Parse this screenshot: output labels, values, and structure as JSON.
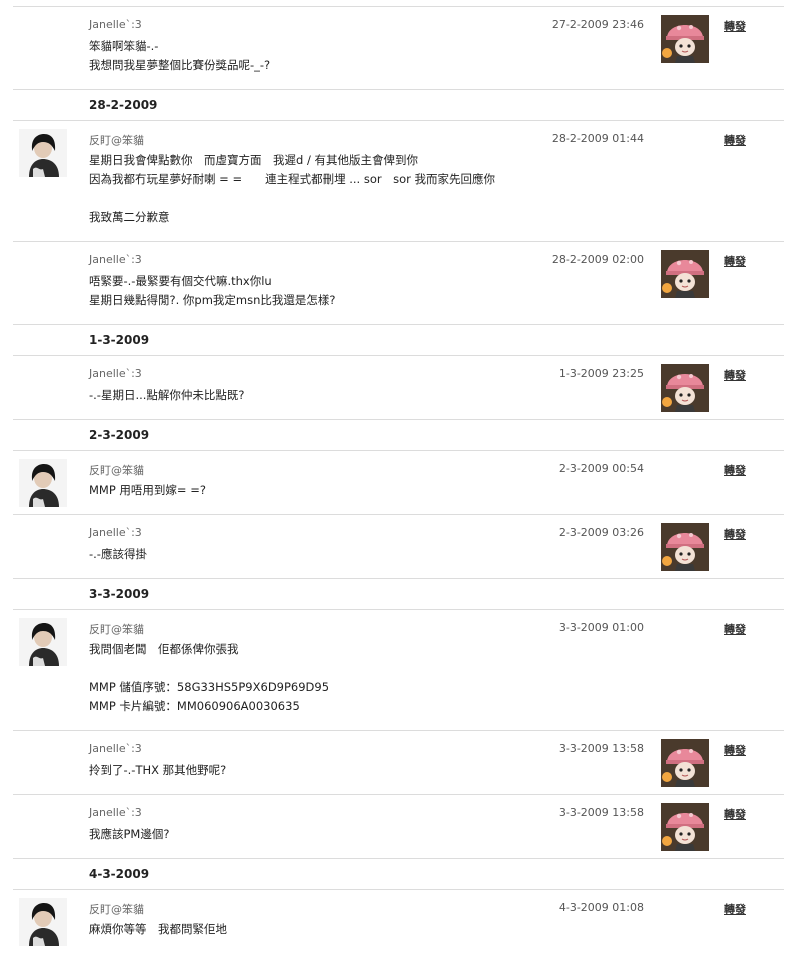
{
  "icons": {
    "left_avatar": "avatar-photo-dark-hair",
    "right_avatar": "pink-hat-doll-avatar"
  },
  "colors": {
    "separator": "#dcdcdc",
    "doll_hat": "#e8889a",
    "doll_bg": "#4a3a2c"
  },
  "forward_label": "轉發",
  "thread": [
    {
      "type": "msg",
      "side": "right",
      "author": "Janelle`:3",
      "time": "27-2-2009 23:46",
      "lines": [
        "笨貓啊笨貓-.-",
        "我想問我星夢整個比賽份獎品呢-_-?"
      ]
    },
    {
      "type": "date",
      "date": "28-2-2009"
    },
    {
      "type": "msg",
      "side": "left",
      "author": "反盯@笨貓",
      "time": "28-2-2009 01:44",
      "lines": [
        "星期日我會俾點數你　而虛寶方面　我遲d / 有其他版主會俾到你",
        "因為我都冇玩星夢好耐喇 = =　　連主程式都刪埋 ... sor　sor 我而家先回應你",
        "",
        "我致萬二分歉意"
      ]
    },
    {
      "type": "msg",
      "side": "right",
      "author": "Janelle`:3",
      "time": "28-2-2009 02:00",
      "lines": [
        "唔緊要-.-最緊要有個交代嘛.thx你lu",
        "星期日幾點得閒?. 你pm我定msn比我還是怎樣?"
      ]
    },
    {
      "type": "date",
      "date": "1-3-2009"
    },
    {
      "type": "msg",
      "side": "right",
      "author": "Janelle`:3",
      "time": "1-3-2009 23:25",
      "lines": [
        "-.-星期日...點解你仲未比點既?"
      ]
    },
    {
      "type": "date",
      "date": "2-3-2009"
    },
    {
      "type": "msg",
      "side": "left",
      "author": "反盯@笨貓",
      "time": "2-3-2009 00:54",
      "lines": [
        "MMP 用唔用到嫁= =?"
      ]
    },
    {
      "type": "msg",
      "side": "right",
      "author": "Janelle`:3",
      "time": "2-3-2009 03:26",
      "lines": [
        "-.-應該得掛"
      ]
    },
    {
      "type": "date",
      "date": "3-3-2009"
    },
    {
      "type": "msg",
      "side": "left",
      "author": "反盯@笨貓",
      "time": "3-3-2009 01:00",
      "lines": [
        "我問個老闆　佢都係俾你張我",
        "",
        "MMP 儲值序號：58G33HS5P9X6D9P69D95",
        "MMP 卡片編號：MM060906A0030635"
      ]
    },
    {
      "type": "msg",
      "side": "right",
      "author": "Janelle`:3",
      "time": "3-3-2009 13:58",
      "lines": [
        "拎到了-.-THX 那其他野呢?"
      ]
    },
    {
      "type": "msg",
      "side": "right",
      "author": "Janelle`:3",
      "time": "3-3-2009 13:58",
      "lines": [
        "我應該PM邊個?"
      ]
    },
    {
      "type": "date",
      "date": "4-3-2009"
    },
    {
      "type": "msg",
      "side": "left",
      "author": "反盯@笨貓",
      "time": "4-3-2009 01:08",
      "lines": [
        "麻煩你等等　我都問緊佢地"
      ]
    }
  ]
}
